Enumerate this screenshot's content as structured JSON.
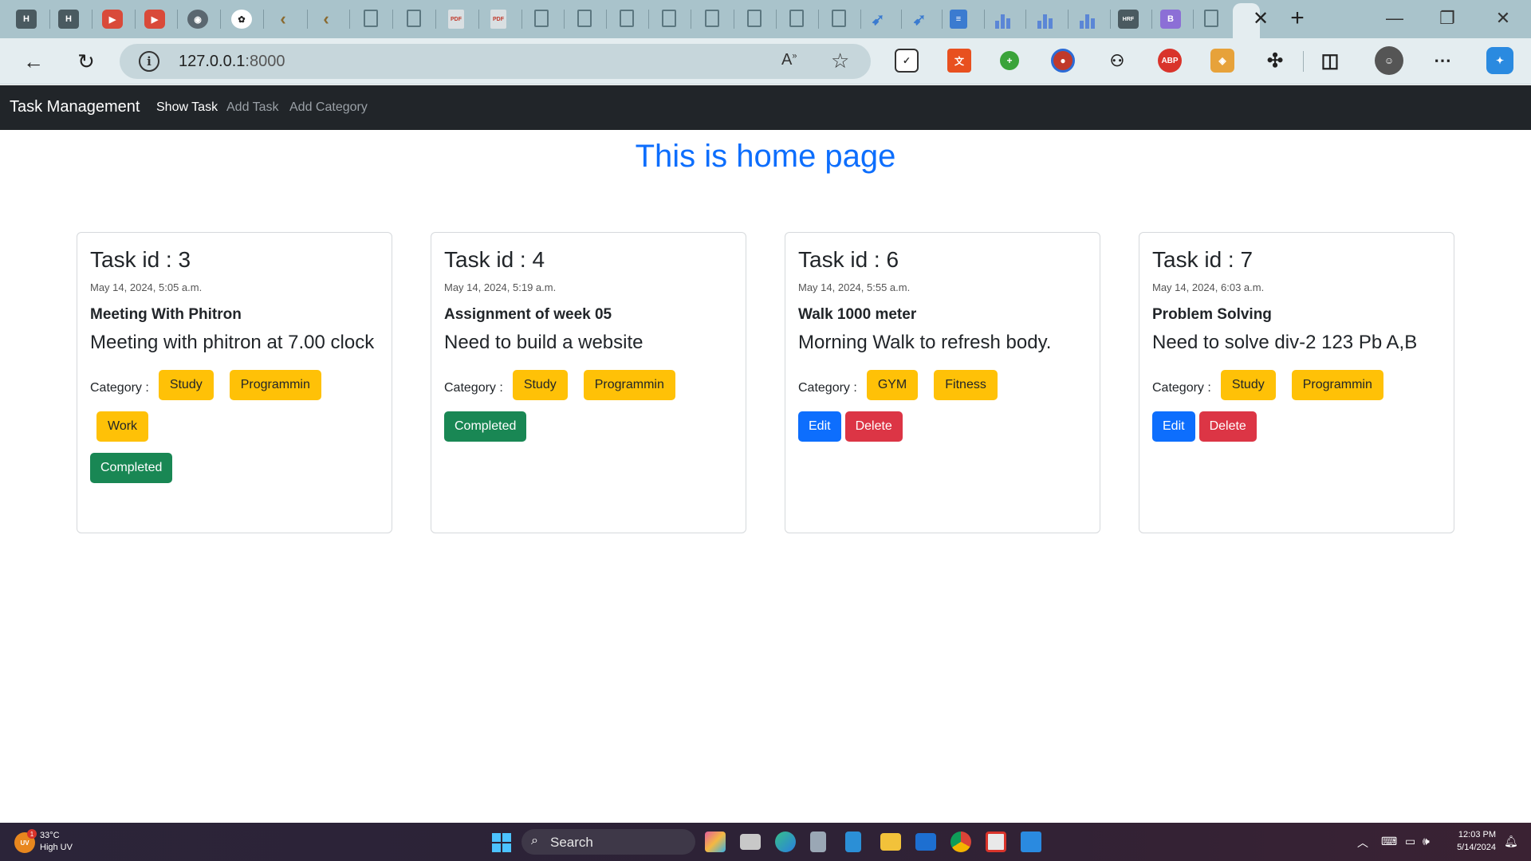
{
  "browser": {
    "url_host": "127.0.0.1",
    "url_port": ":8000",
    "colors": {
      "tabstrip": "#a9c3cb",
      "toolbar": "#e4edf0",
      "omnibox": "#c6d6db"
    }
  },
  "navbar": {
    "brand": "Task Management",
    "links": [
      {
        "label": "Show Task",
        "active": true
      },
      {
        "label": "Add Task",
        "active": false
      },
      {
        "label": "Add Category",
        "active": false
      }
    ]
  },
  "main": {
    "title": "This is home page",
    "category_label": "Category :",
    "cards": [
      {
        "title": "Task id : 3",
        "date": "May 14, 2024, 5:05 a.m.",
        "heading": "Meeting With Phitron",
        "description": "Meeting with phitron at 7.00 clock",
        "categories": [
          "Study",
          "Programmin",
          "Work"
        ],
        "buttons": {
          "completed": "Completed"
        }
      },
      {
        "title": "Task id : 4",
        "date": "May 14, 2024, 5:19 a.m.",
        "heading": "Assignment of week 05",
        "description": "Need to build a website",
        "categories": [
          "Study",
          "Programmin"
        ],
        "buttons": {
          "completed": "Completed"
        }
      },
      {
        "title": "Task id : 6",
        "date": "May 14, 2024, 5:55 a.m.",
        "heading": "Walk 1000 meter",
        "description": "Morning Walk to refresh body.",
        "categories": [
          "GYM",
          "Fitness"
        ],
        "buttons": {
          "edit": "Edit",
          "delete": "Delete"
        }
      },
      {
        "title": "Task id : 7",
        "date": "May 14, 2024, 6:03 a.m.",
        "heading": "Problem Solving",
        "description": "Need to solve div-2 123 Pb A,B",
        "categories": [
          "Study",
          "Programmin"
        ],
        "buttons": {
          "edit": "Edit",
          "delete": "Delete"
        }
      }
    ],
    "colors": {
      "title": "#0d6efd",
      "badge": "#ffc107",
      "completed": "#198754",
      "edit": "#0d6efd",
      "delete": "#dc3545"
    }
  },
  "taskbar": {
    "weather_temp": "33°C",
    "weather_desc": "High UV",
    "weather_badge": "1",
    "weather_icon_text": "UV",
    "search_label": "Search",
    "clock_time": "12:03 PM",
    "clock_date": "5/14/2024"
  }
}
